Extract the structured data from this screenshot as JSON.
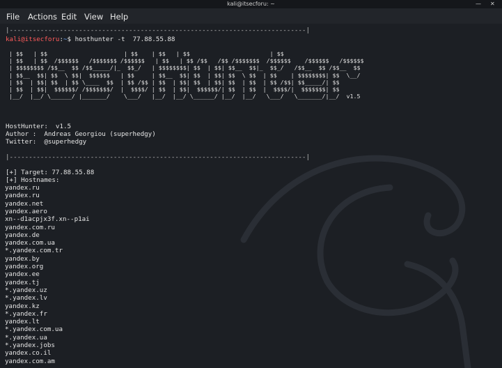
{
  "window": {
    "title": "kali@itsecforu: ~",
    "minimize_glyph": "—",
    "close_glyph": "✕"
  },
  "menu": {
    "items": [
      "File",
      "Actions",
      "Edit",
      "View",
      "Help"
    ]
  },
  "terminal": {
    "divider": "|-----------------------------------------------------------------------------|",
    "prompt_user": "kali@itsecforu",
    "prompt_sep": ":",
    "prompt_path": "~",
    "prompt_symbol": "$",
    "command": "hosthunter -t  77.88.55.88",
    "banner_version": "v1.5",
    "info": [
      "HostHunter:  v1.5",
      "Author :  Andreas Georgiou (superhedgy)",
      "Twitter:  @superhedgy"
    ],
    "target_line": "[+] Target: 77.88.55.88",
    "hostnames_line": "[+] Hostnames:",
    "hostnames": [
      "yandex.ru",
      "yandex.ru",
      "yandex.net",
      "yandex.aero",
      "xn--d1acpjx3f.xn--p1ai",
      "yandex.com.ru",
      "yandex.de",
      "yandex.com.ua",
      "*.yandex.com.tr",
      "yandex.by",
      "yandex.org",
      "yandex.ee",
      "yandex.tj",
      "*.yandex.uz",
      "*.yandex.lv",
      "yandex.kz",
      "*.yandex.fr",
      "yandex.lt",
      "*.yandex.com.ua",
      "*.yandex.ua",
      "*.yandex.jobs",
      "yandex.co.il",
      "yandex.com.am"
    ]
  },
  "colors": {
    "background": "#1c1f24",
    "prompt_user": "#ff5b5b",
    "prompt_path": "#6fa8ff",
    "text": "#e6e6e6"
  }
}
